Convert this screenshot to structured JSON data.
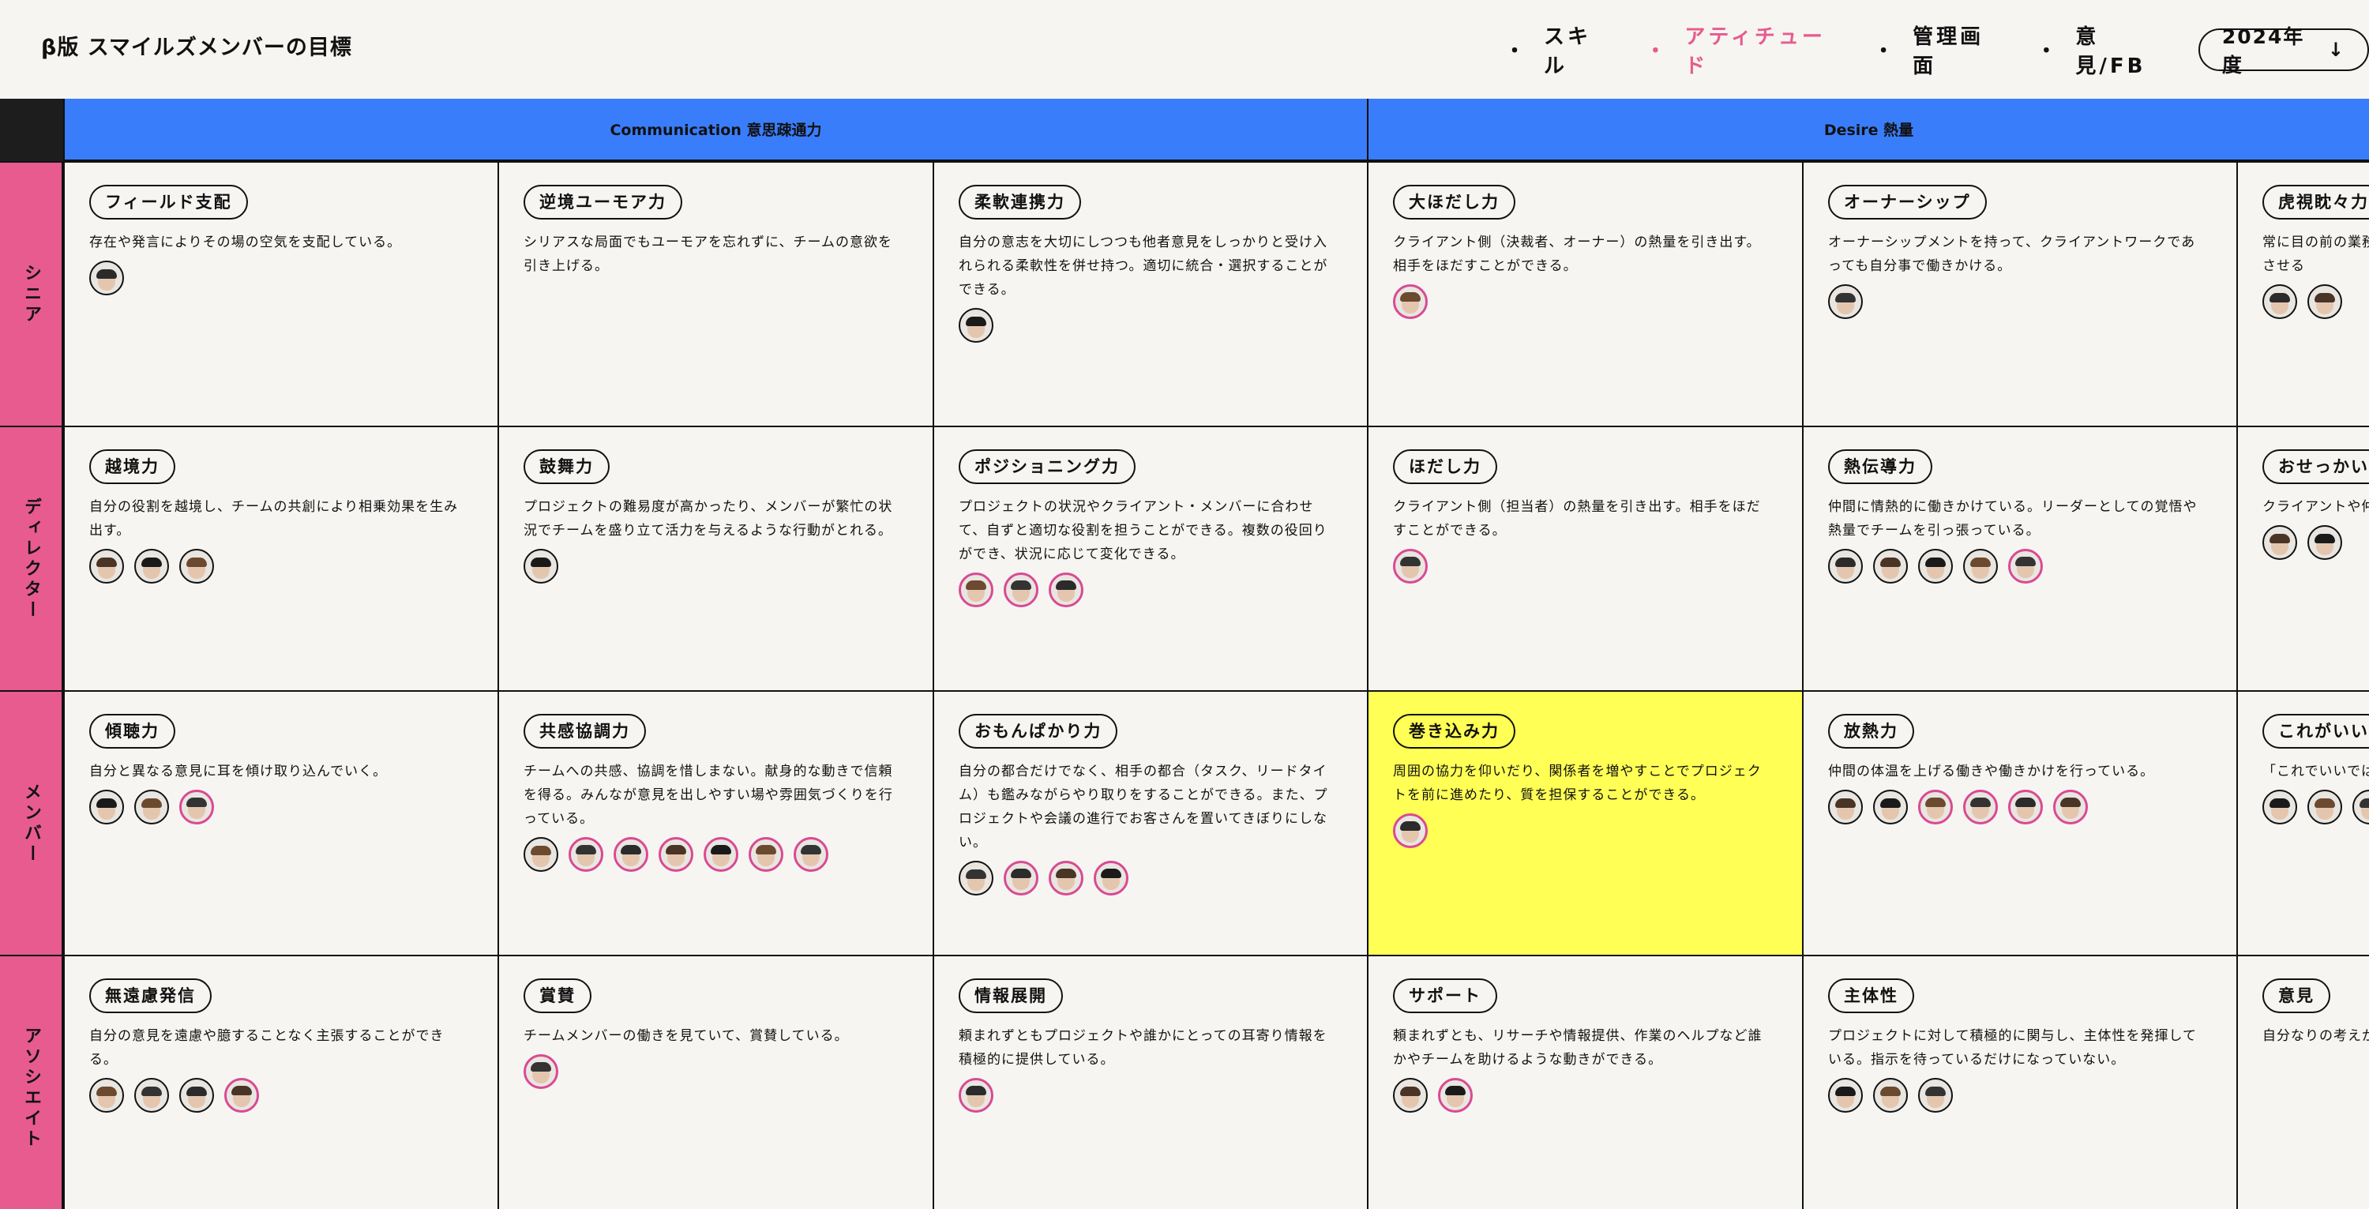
{
  "header": {
    "title": "β版 スマイルズメンバーの目標",
    "nav": [
      {
        "label": "スキル",
        "active": false
      },
      {
        "label": "アティチュード",
        "active": true
      },
      {
        "label": "管理画面",
        "active": false
      },
      {
        "label": "意見/FB",
        "active": false
      }
    ],
    "nav_bullet": "・",
    "year": "2024年度",
    "year_icon": "↓"
  },
  "colors": {
    "accent": "#e75b8e",
    "category": "#3a7dfb",
    "highlight": "#ffff55"
  },
  "categories": [
    {
      "label": "Communication 意思疎通力"
    },
    {
      "label": "Desire 熱量"
    }
  ],
  "levels": [
    "シニア",
    "ディレクター",
    "メンバー",
    "アソシエイト"
  ],
  "rows": [
    [
      {
        "title": "フィールド支配",
        "desc": "存在や発言によりその場の空気を支配している。",
        "members": [
          "n"
        ]
      },
      {
        "title": "逆境ユーモア力",
        "desc": "シリアスな局面でもユーモアを忘れずに、チームの意欲を引き上げる。",
        "members": []
      },
      {
        "title": "柔軟連携力",
        "desc": "自分の意志を大切にしつつも他者意見をしっかりと受け入れられる柔軟性を併せ持つ。適切に統合・選択することができる。",
        "members": [
          "n"
        ]
      },
      {
        "title": "大ほだし力",
        "desc": "クライアント側（決裁者、オーナー）の熱量を引き出す。相手をほだすことができる。",
        "members": [
          "p"
        ]
      },
      {
        "title": "オーナーシップ",
        "desc": "オーナーシップメントを持って、クライアントワークであっても自分事で働きかける。",
        "members": [
          "n"
        ]
      },
      {
        "title": "虎視眈々力",
        "desc": "常に目の前の業務目線でのゴールを見据えて、それを結実させる",
        "members": [
          "n",
          "n"
        ]
      }
    ],
    [
      {
        "title": "越境力",
        "desc": "自分の役割を越境し、チームの共創により相乗効果を生み出す。",
        "members": [
          "n",
          "n",
          "n"
        ]
      },
      {
        "title": "鼓舞力",
        "desc": "プロジェクトの難易度が高かったり、メンバーが繁忙の状況でチームを盛り立て活力を与えるような行動がとれる。",
        "members": [
          "n"
        ]
      },
      {
        "title": "ポジショニング力",
        "desc": "プロジェクトの状況やクライアント・メンバーに合わせて、自ずと適切な役割を担うことができる。複数の役回りができ、状況に応じて変化できる。",
        "members": [
          "p",
          "p",
          "p"
        ]
      },
      {
        "title": "ほだし力",
        "desc": "クライアント側（担当者）の熱量を引き出す。相手をほだすことができる。",
        "members": [
          "p"
        ]
      },
      {
        "title": "熱伝導力",
        "desc": "仲間に情熱的に働きかけている。リーダーとしての覚悟や熱量でチームを引っ張っている。",
        "members": [
          "n",
          "n",
          "n",
          "n",
          "p"
        ]
      },
      {
        "title": "おせっかい",
        "desc": "クライアントや仲間が行える。（＋アルファ",
        "members": [
          "n",
          "n"
        ]
      }
    ],
    [
      {
        "title": "傾聴力",
        "desc": "自分と異なる意見に耳を傾け取り込んでいく。",
        "members": [
          "n",
          "n",
          "p"
        ]
      },
      {
        "title": "共感協調力",
        "desc": "チームへの共感、協調を惜しまない。献身的な動きで信頼を得る。みんなが意見を出しやすい場や雰囲気づくりを行っている。",
        "members": [
          "n",
          "p",
          "p",
          "p",
          "p",
          "p",
          "p"
        ]
      },
      {
        "title": "おもんぱかり力",
        "desc": "自分の都合だけでなく、相手の都合（タスク、リードタイム）も鑑みながらやり取りをすることができる。また、プロジェクトや会議の進行でお客さんを置いてきぼりにしない。",
        "members": [
          "n",
          "p",
          "p",
          "p"
        ]
      },
      {
        "title": "巻き込み力",
        "desc": "周囲の協力を仰いだり、関係者を増やすことでプロジェクトを前に進めたり、質を担保することができる。",
        "members": [
          "p"
        ],
        "highlight": true
      },
      {
        "title": "放熱力",
        "desc": "仲間の体温を上げる働きや働きかけを行っている。",
        "members": [
          "n",
          "n",
          "p",
          "p",
          "p",
          "p"
        ]
      },
      {
        "title": "これがいい",
        "desc": "「これでいいでは向き合っている",
        "members": [
          "n",
          "n",
          "n",
          "p",
          "p"
        ]
      }
    ],
    [
      {
        "title": "無遠慮発信",
        "desc": "自分の意見を遠慮や臆することなく主張することができる。",
        "members": [
          "n",
          "n",
          "n",
          "p"
        ]
      },
      {
        "title": "賞賛",
        "desc": "チームメンバーの働きを見ていて、賞賛している。",
        "members": [
          "p"
        ]
      },
      {
        "title": "情報展開",
        "desc": "頼まれずともプロジェクトや誰かにとっての耳寄り情報を積極的に提供している。",
        "members": [
          "p"
        ]
      },
      {
        "title": "サポート",
        "desc": "頼まれずとも、リサーチや情報提供、作業のヘルプなど誰かやチームを助けるような動きができる。",
        "members": [
          "n",
          "p"
        ]
      },
      {
        "title": "主体性",
        "desc": "プロジェクトに対して積極的に関与し、主体性を発揮している。指示を待っているだけになっていない。",
        "members": [
          "n",
          "n",
          "n"
        ]
      },
      {
        "title": "意見",
        "desc": "自分なりの考えがいい」という意",
        "members": []
      }
    ]
  ]
}
